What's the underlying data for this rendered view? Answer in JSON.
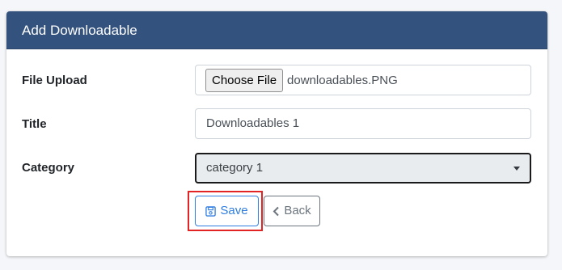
{
  "card": {
    "title": "Add Downloadable"
  },
  "form": {
    "file_upload": {
      "label": "File Upload",
      "button_label": "Choose File",
      "file_name": "downloadables.PNG"
    },
    "title": {
      "label": "Title",
      "value": "Downloadables 1"
    },
    "category": {
      "label": "Category",
      "selected": "category 1"
    }
  },
  "actions": {
    "save_label": "Save",
    "back_label": "Back",
    "save_icon": "floppy-disk-icon",
    "back_icon": "chevron-left-icon"
  },
  "colors": {
    "header_bg": "#34527e",
    "save_accent": "#2f7de1",
    "highlight_border": "#e32424"
  }
}
